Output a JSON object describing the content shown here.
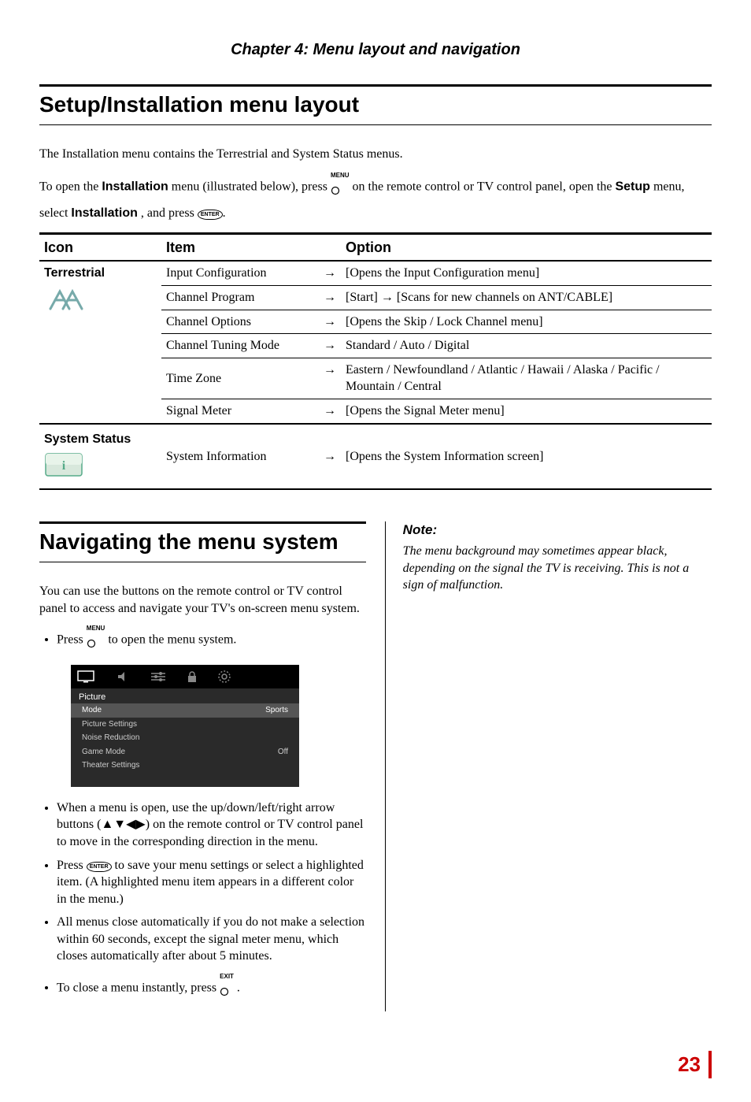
{
  "chapter_title": "Chapter 4: Menu layout and navigation",
  "section1": {
    "title": "Setup/Installation menu layout",
    "intro1": "The Installation menu contains the Terrestrial and System Status menus.",
    "open_pre": "To open the ",
    "installation_word": "Installation",
    "open_mid": " menu (illustrated below), press ",
    "menu_btn_label": "MENU",
    "open_post1": " on the remote control or TV control panel, open the ",
    "setup_word": "Setup",
    "open_post2": " menu, select ",
    "installation_word2": "Installation",
    "open_post3": ", and press ",
    "enter_label": "ENTER",
    "open_post4": "."
  },
  "table": {
    "headers": {
      "icon": "Icon",
      "item": "Item",
      "option": "Option"
    },
    "terrestrial_label": "Terrestrial",
    "rows_terrestrial": [
      {
        "item": "Input Configuration",
        "option": "[Opens the Input Configuration menu]"
      },
      {
        "item": "Channel Program",
        "option_pre": "[Start] ",
        "option_post": " [Scans for new channels on ANT/CABLE]"
      },
      {
        "item": "Channel Options",
        "option": "[Opens the Skip / Lock Channel menu]"
      },
      {
        "item": "Channel Tuning Mode",
        "option": "Standard / Auto / Digital"
      },
      {
        "item": "Time Zone",
        "option": "Eastern / Newfoundland / Atlantic / Hawaii / Alaska / Pacific / Mountain / Central"
      },
      {
        "item": "Signal Meter",
        "option": "[Opens the Signal Meter menu]"
      }
    ],
    "system_status_label": "System Status",
    "system_row": {
      "item": "System Information",
      "option": "[Opens the System Information screen]"
    }
  },
  "section2": {
    "title": "Navigating the menu system",
    "intro": "You can use the buttons on the remote control or TV control panel to access and navigate your TV's on-screen menu system.",
    "bullet1_pre": "Press ",
    "menu_btn_label": "MENU",
    "bullet1_post": " to open the menu system.",
    "osd": {
      "section": "Picture",
      "rows": [
        {
          "label": "Mode",
          "value": "Sports"
        },
        {
          "label": "Picture Settings",
          "value": ""
        },
        {
          "label": "Noise Reduction",
          "value": ""
        },
        {
          "label": "Game Mode",
          "value": "Off"
        },
        {
          "label": "Theater Settings",
          "value": ""
        }
      ]
    },
    "bullet2_pre": "When a menu is open, use the up/down/left/right arrow buttons (",
    "arrow_glyphs": "▲▼◀▶",
    "bullet2_post": ") on the remote control or TV control panel to move in the corresponding direction in the menu.",
    "bullet3_pre": "Press ",
    "enter_label": "ENTER",
    "bullet3_post": " to save your menu settings or select a highlighted item. (A highlighted menu item appears in a different color in the menu.)",
    "bullet4": "All menus close automatically if you do not make a selection within 60 seconds, except the signal meter menu, which closes automatically after about 5 minutes.",
    "bullet5_pre": "To close a menu instantly, press ",
    "exit_btn_label": "EXIT",
    "bullet5_post": "."
  },
  "note": {
    "head": "Note:",
    "body": "The menu background may sometimes appear black, depending on the signal the TV is receiving. This is not a sign of malfunction."
  },
  "page_number": "23"
}
